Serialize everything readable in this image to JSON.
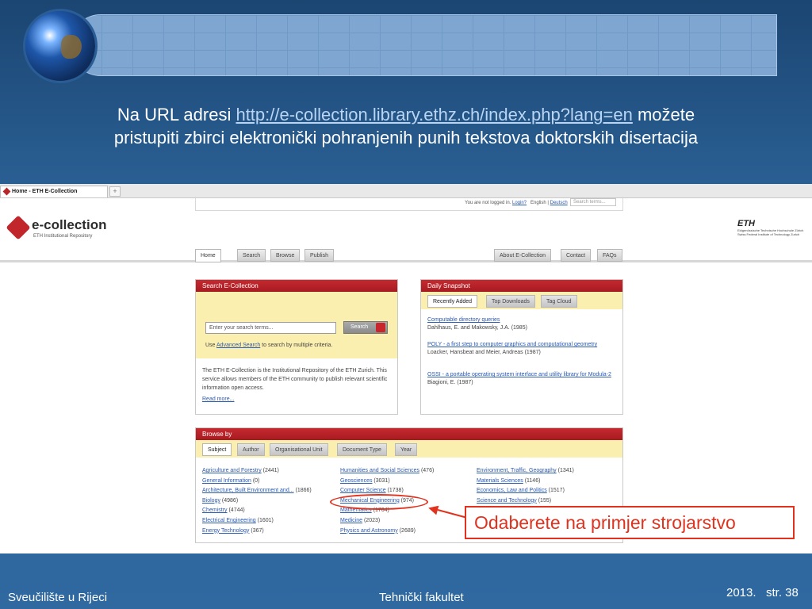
{
  "slide": {
    "title_prefix": "Na URL adresi ",
    "url": "http://e-collection.library.ethz.ch/index.php?lang=en",
    "title_suffix": " možete",
    "title_line2": "pristupiti zbirci elektronički pohranjenih punih tekstova doktorskih disertacija",
    "callout": "Odaberete na primjer strojarstvo",
    "footer_left": "Sveučilište u Rijeci",
    "footer_center": "Tehnički fakultet",
    "footer_year": "2013.",
    "footer_page": "str. 38"
  },
  "browser": {
    "tab_title": "Home - ETH E-Collection",
    "new_tab": "+"
  },
  "site": {
    "login_text": "You are not logged in.",
    "login": "Login?",
    "lang_en": "English",
    "lang_sep": " | ",
    "lang_de": "Deutsch",
    "search_placeholder": "Search terms...",
    "logo": "e-collection",
    "logo_sub": "ETH Institutional Repository",
    "eth": "ETH",
    "eth_sub1": "Eidgenössische Technische Hochschule Zürich",
    "eth_sub2": "Swiss Federal Institute of Technology Zurich",
    "nav": [
      "Home",
      "Search",
      "Browse",
      "Publish"
    ],
    "nav_right": [
      "About E-Collection",
      "Contact",
      "FAQs"
    ]
  },
  "search_panel": {
    "title": "Search E-Collection",
    "placeholder": "Enter your search terms...",
    "button": "Search",
    "hint_pre": "Use ",
    "hint_link": "Advanced Search",
    "hint_post": " to search by multiple criteria.",
    "desc": "The ETH E-Collection is the Institutional Repository of the ETH Zurich. This service allows members of the ETH community to publish relevant scientific information open access.",
    "read_more": "Read more..."
  },
  "snapshot": {
    "title": "Daily Snapshot",
    "tabs": [
      "Recently Added",
      "Top Downloads",
      "Tag Cloud"
    ],
    "items": [
      {
        "title": "Computable directory queries",
        "authors": "Dahlhaus, E. and Makowsky, J.A. (1985)"
      },
      {
        "title": "POLY - a first step to computer graphics and computational geometry",
        "authors": "Loacker, Hansbeat and Meier, Andreas (1987)"
      },
      {
        "title": "OSSI - a portable operating system interface and utility library for Modula-2",
        "authors": "Biagioni, E. (1987)"
      }
    ]
  },
  "browse": {
    "title": "Browse by",
    "tabs": [
      "Subject",
      "Author",
      "Organisational Unit",
      "Document Type",
      "Year"
    ],
    "col1": [
      {
        "name": "Agriculture and Forestry",
        "count": "(2441)"
      },
      {
        "name": "General Information",
        "count": "(0)"
      },
      {
        "name": "Architecture, Built Environment and...",
        "count": "(1866)"
      },
      {
        "name": "Biology",
        "count": "(4986)"
      },
      {
        "name": "Chemistry",
        "count": "(4744)"
      },
      {
        "name": "Electrical Engineering",
        "count": "(1601)"
      },
      {
        "name": "Energy Technology",
        "count": "(367)"
      }
    ],
    "col2": [
      {
        "name": "Humanities and Social Sciences",
        "count": "(476)"
      },
      {
        "name": "Geosciences",
        "count": "(3031)"
      },
      {
        "name": "Computer Science",
        "count": "(1738)"
      },
      {
        "name": "Mechanical Engineering",
        "count": "(974)"
      },
      {
        "name": "Mathematics",
        "count": "(1764)"
      },
      {
        "name": "Medicine",
        "count": "(2023)"
      },
      {
        "name": "Physics and Astronomy",
        "count": "(2689)"
      }
    ],
    "col3": [
      {
        "name": "Environment, Traffic, Geography",
        "count": "(1341)"
      },
      {
        "name": "Materials Sciences",
        "count": "(1146)"
      },
      {
        "name": "Economics, Law and Politics",
        "count": "(1517)"
      },
      {
        "name": "Science and Technology",
        "count": "(155)"
      }
    ]
  }
}
